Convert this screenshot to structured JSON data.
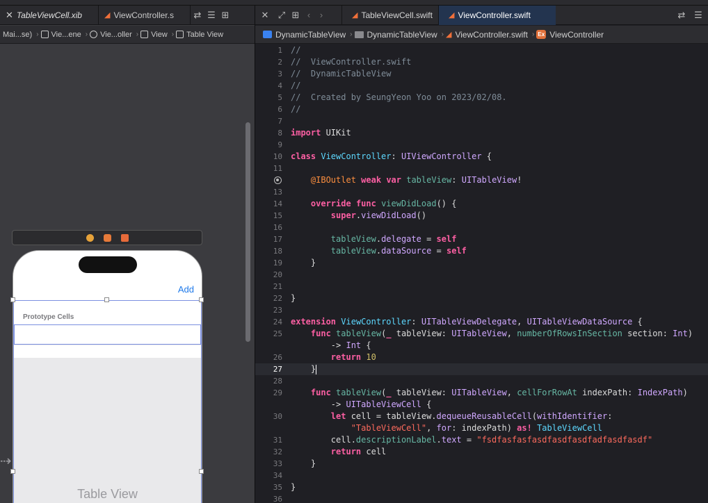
{
  "left_tabs": {
    "xib_tab": "TableViewCell.xib",
    "swift_tab": "ViewController.s"
  },
  "left_breadcrumb": [
    "Mai...se)",
    "Vie...ene",
    "Vie...oller",
    "View",
    "Table View"
  ],
  "ib": {
    "nav_button": "Add",
    "section_label": "Prototype Cells",
    "table_label": "Table View"
  },
  "right_tabs": {
    "tab1": "TableViewCell.swift",
    "tab2": "ViewController.swift"
  },
  "right_breadcrumb": [
    "DynamicTableView",
    "DynamicTableView",
    "ViewController.swift",
    "ViewController"
  ],
  "code": {
    "line_numbers": [
      "1",
      "2",
      "3",
      "4",
      "5",
      "6",
      "7",
      "8",
      "9",
      "10",
      "11",
      "",
      "13",
      "14",
      "15",
      "16",
      "17",
      "18",
      "19",
      "20",
      "21",
      "22",
      "23",
      "24",
      "25",
      "",
      "26",
      "27",
      "28",
      "29",
      "",
      "30",
      "",
      "31",
      "32",
      "33",
      "34",
      "35",
      "36"
    ],
    "comment_lines": [
      "//",
      "//  ViewController.swift",
      "//  DynamicTableView",
      "//",
      "//  Created by SeungYeon Yoo on 2023/02/08.",
      "//"
    ],
    "return_value": "10",
    "cell_identifier": "\"TableViewCell\"",
    "label_text": "\"fsdfasfasfasdfasdfasdfadfasdfasdf\""
  },
  "colors": {
    "accent_tab": "#23344f",
    "ib_link": "#1f7aea",
    "keyword": "#fc5fa3",
    "string": "#fc6a5d"
  }
}
